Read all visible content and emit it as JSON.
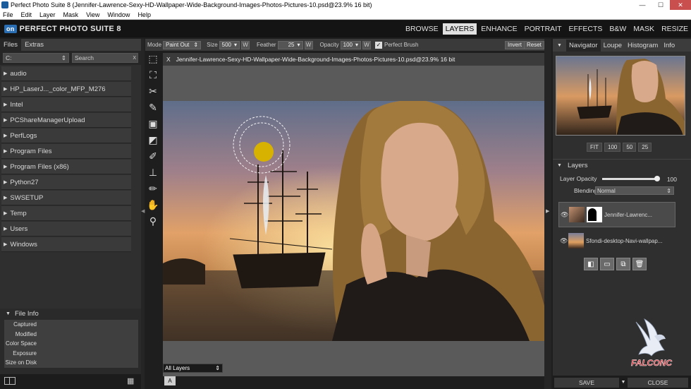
{
  "window": {
    "title": "Perfect Photo Suite 8 (Jennifer-Lawrence-Sexy-HD-Wallpaper-Wide-Background-Images-Photos-Pictures-10.psd@23.9% 16 bit)"
  },
  "menubar": {
    "items": [
      "File",
      "Edit",
      "Layer",
      "Mask",
      "View",
      "Window",
      "Help"
    ]
  },
  "brand": {
    "logo": "on",
    "name": "PERFECT PHOTO SUITE 8"
  },
  "modules": [
    "BROWSE",
    "LAYERS",
    "ENHANCE",
    "PORTRAIT",
    "EFFECTS",
    "B&W",
    "MASK",
    "RESIZE"
  ],
  "left": {
    "tabs": [
      "Files",
      "Extras"
    ],
    "drive": "C:",
    "search_placeholder": "Search",
    "folders": [
      "audio",
      "HP_LaserJ..._color_MFP_M276",
      "Intel",
      "PCShareManagerUpload",
      "PerfLogs",
      "Program Files",
      "Program Files (x86)",
      "Python27",
      "SWSETUP",
      "Temp",
      "Users",
      "Windows"
    ],
    "fileinfo": {
      "title": "File Info",
      "rows": [
        "Captured",
        "Modified",
        "Color Space",
        "Exposure",
        "Size on Disk"
      ]
    }
  },
  "options": {
    "mode_label": "Mode",
    "mode_value": "Paint Out",
    "size_label": "Size",
    "size_value": "500",
    "feather_label": "Feather",
    "feather_value": "25",
    "opacity_label": "Opacity",
    "opacity_value": "100",
    "w": "W",
    "perfect_brush": "Perfect Brush",
    "invert": "Invert",
    "reset": "Reset"
  },
  "document": {
    "tab": "Jennifer-Lawrence-Sexy-HD-Wallpaper-Wide-Background-Images-Photos-Pictures-10.psd@23.9% 16 bit",
    "close": "X",
    "layer_filter": "All Layers",
    "a_button": "A"
  },
  "right": {
    "tabs": [
      "Navigator",
      "Loupe",
      "Histogram",
      "Info"
    ],
    "zoom": [
      "FIT",
      "100",
      "50",
      "25"
    ],
    "layers": {
      "title": "Layers",
      "opacity_label": "Layer Opacity",
      "opacity_value": "100",
      "blend_label": "Blending",
      "blend_value": "Normal",
      "items": [
        {
          "name": "Jennifer-Lawrenc..."
        },
        {
          "name": "Sfondi-desktop-Navi-wallpap..."
        }
      ]
    },
    "save": "SAVE",
    "close": "CLOSE"
  },
  "watermark": "FALCONC",
  "colors": {
    "accent": "#2a6db0",
    "dark": "#141414",
    "panel": "#2f2f2f"
  }
}
